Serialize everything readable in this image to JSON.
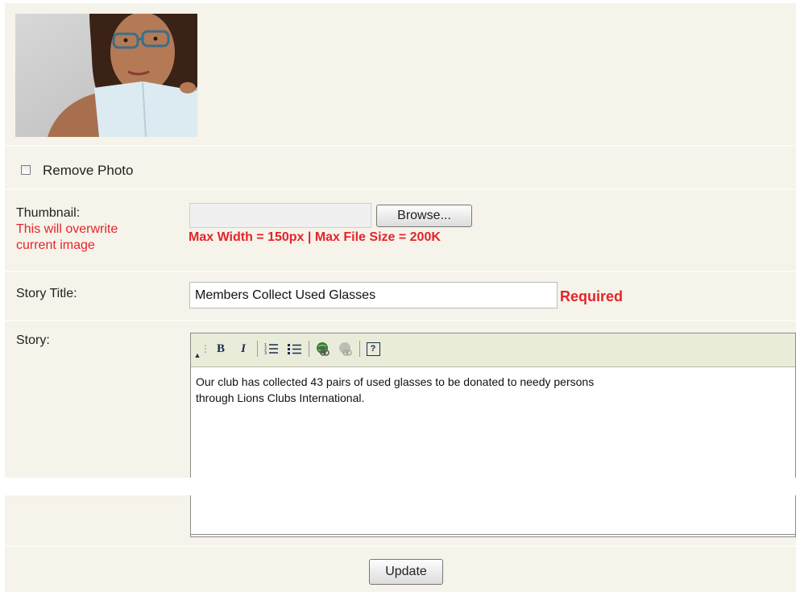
{
  "photo": {
    "alt": "woman with glasses reading a book"
  },
  "remove_photo": {
    "label": "Remove Photo",
    "checked": false
  },
  "thumbnail": {
    "label": "Thumbnail:",
    "warning_line1": "This will overwrite",
    "warning_line2": "current image",
    "browse_label": "Browse...",
    "limits": "Max Width = 150px | Max File Size = 200K"
  },
  "story_title": {
    "label": "Story Title:",
    "value": "Members Collect Used Glasses",
    "required": "Required"
  },
  "story": {
    "label": "Story:",
    "toolbar": {
      "bold": "B",
      "italic": "I",
      "help": "?"
    },
    "text_line1": "Our club has collected 43 pairs of used glasses to be donated to needy persons",
    "text_line2": "through Lions Clubs International."
  },
  "update_label": "Update",
  "colors": {
    "panel": "#f6f3ea",
    "toolbar": "#e9ecd9",
    "error": "#e5242a"
  }
}
